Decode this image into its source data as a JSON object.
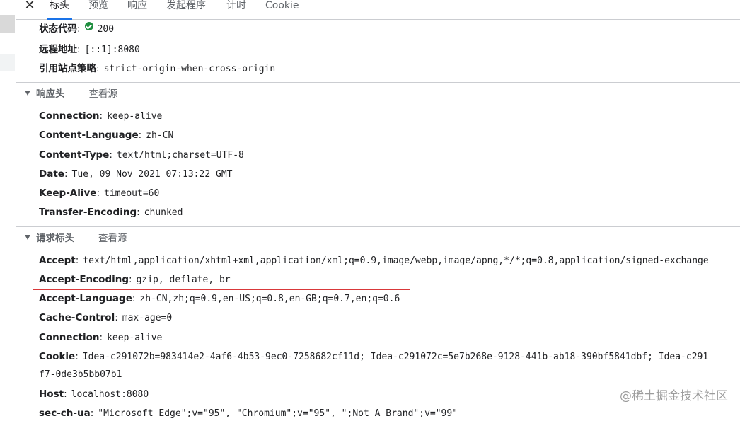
{
  "tabs": [
    {
      "label": "标头",
      "active": true
    },
    {
      "label": "预览"
    },
    {
      "label": "响应"
    },
    {
      "label": "发起程序"
    },
    {
      "label": "计时"
    },
    {
      "label": "Cookie"
    }
  ],
  "general": [
    {
      "key": "状态代码",
      "value": "200"
    },
    {
      "key": "远程地址",
      "value": "[::1]:8080"
    },
    {
      "key": "引用站点策略",
      "value": "strict-origin-when-cross-origin"
    }
  ],
  "response_headers": {
    "title": "响应头",
    "view_source": "查看源",
    "items": [
      {
        "key": "Connection",
        "value": "keep-alive"
      },
      {
        "key": "Content-Language",
        "value": "zh-CN"
      },
      {
        "key": "Content-Type",
        "value": "text/html;charset=UTF-8"
      },
      {
        "key": "Date",
        "value": "Tue, 09 Nov 2021 07:13:22 GMT"
      },
      {
        "key": "Keep-Alive",
        "value": "timeout=60"
      },
      {
        "key": "Transfer-Encoding",
        "value": "chunked"
      }
    ]
  },
  "request_headers": {
    "title": "请求标头",
    "view_source": "查看源",
    "items": [
      {
        "key": "Accept",
        "value": "text/html,application/xhtml+xml,application/xml;q=0.9,image/webp,image/apng,*/*;q=0.8,application/signed-exchange"
      },
      {
        "key": "Accept-Encoding",
        "value": "gzip, deflate, br"
      },
      {
        "key": "Accept-Language",
        "value": "zh-CN,zh;q=0.9,en-US;q=0.8,en-GB;q=0.7,en;q=0.6"
      },
      {
        "key": "Cache-Control",
        "value": "max-age=0"
      },
      {
        "key": "Connection",
        "value": "keep-alive"
      },
      {
        "key": "Cookie",
        "value": "Idea-c291072b=983414e2-4af6-4b53-9ec0-7258682cf11d; Idea-c291072c=5e7b268e-9128-441b-ab18-390bf5841dbf; Idea-c291",
        "continuation": "f7-0de3b5bb07b1"
      },
      {
        "key": "Host",
        "value": "localhost:8080"
      },
      {
        "key": "sec-ch-ua",
        "value": "\"Microsoft Edge\";v=\"95\", \"Chromium\";v=\"95\", \";Not A Brand\";v=\"99\""
      }
    ]
  },
  "watermark": "@稀土掘金技术社区",
  "colors": {
    "accent": "#1a73e8",
    "status_ok": "#1e8e3e",
    "highlight_box": "#d9383a"
  },
  "icons": {
    "close": "close-icon",
    "status": "check-circle-icon",
    "collapse": "triangle-down-icon"
  }
}
